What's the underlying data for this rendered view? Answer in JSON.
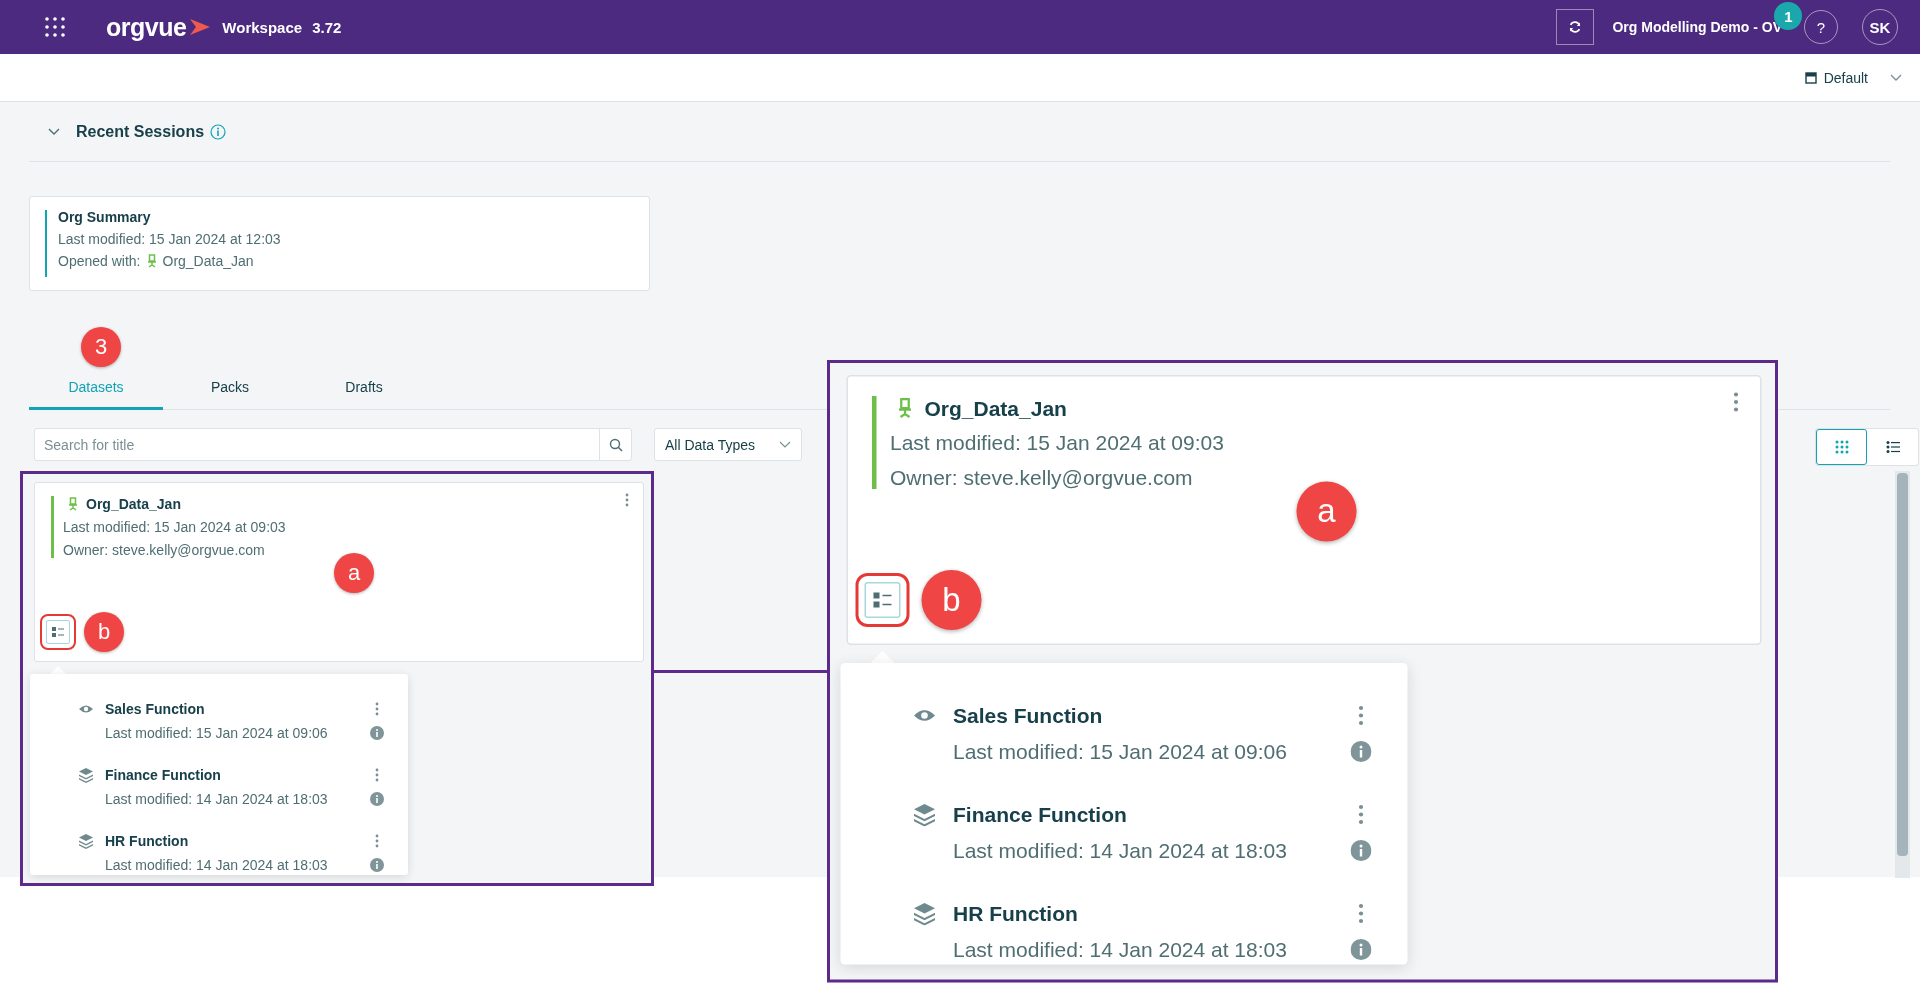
{
  "top_bar": {
    "logo_text": "orgvue",
    "app_name": "Workspace",
    "version": "3.72",
    "workspace_name": "Org Modelling Demo - OV",
    "help_label": "?",
    "help_annotation": "1",
    "user_initials": "SK"
  },
  "layout_selector": {
    "label": "Default"
  },
  "recent_sessions": {
    "title": "Recent Sessions",
    "expanded": true,
    "items": [
      {
        "title": "Org Summary",
        "modified": "Last modified: 15 Jan 2024 at 12:03",
        "opened_with_label": "Opened with:",
        "opened_with": "Org_Data_Jan"
      }
    ]
  },
  "tabs_annotation": "3",
  "tabs": [
    {
      "label": "Datasets",
      "selected": true
    },
    {
      "label": "Packs",
      "selected": false
    },
    {
      "label": "Drafts",
      "selected": false
    }
  ],
  "search": {
    "placeholder": "Search for title"
  },
  "type_filter": {
    "value": "All Data Types"
  },
  "view_toggle": [
    {
      "kind": "grid",
      "selected": true
    },
    {
      "kind": "list",
      "selected": false
    }
  ],
  "dataset_frame": {
    "card": {
      "title": "Org_Data_Jan",
      "modified": "Last modified: 15 Jan 2024 at 09:03",
      "owner": "Owner: steve.kelly@orgvue.com"
    },
    "card_annotation": "a",
    "button_annotation": "b",
    "views": [
      {
        "kind": "view",
        "title": "Sales Function",
        "modified": "Last modified: 15 Jan 2024 at 09:06"
      },
      {
        "kind": "layers",
        "title": "Finance Function",
        "modified": "Last modified: 14 Jan 2024 at 18:03"
      },
      {
        "kind": "layers",
        "title": "HR Function",
        "modified": "Last modified: 14 Jan 2024 at 18:03"
      }
    ]
  },
  "magnified_callout": {
    "card": {
      "title": "Org_Data_Jan",
      "modified": "Last modified: 15 Jan 2024 at 09:03",
      "owner": "Owner: steve.kelly@orgvue.com"
    },
    "card_annotation": "a",
    "button_annotation": "b",
    "views": [
      {
        "kind": "view",
        "title": "Sales Function",
        "modified": "Last modified: 15 Jan 2024 at 09:06"
      },
      {
        "kind": "layers",
        "title": "Finance Function",
        "modified": "Last modified: 14 Jan 2024 at 18:03"
      },
      {
        "kind": "layers",
        "title": "HR Function",
        "modified": "Last modified: 14 Jan 2024 at 18:03"
      }
    ]
  }
}
